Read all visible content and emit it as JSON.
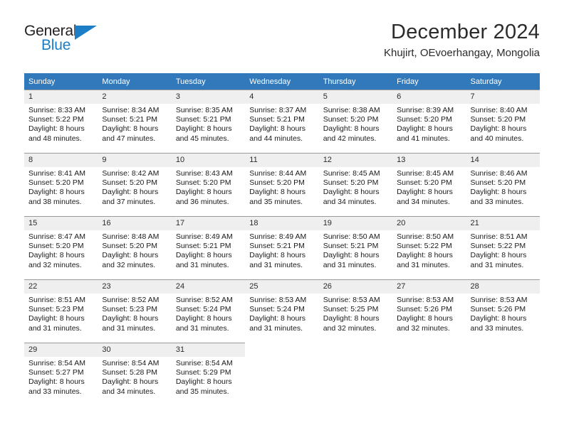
{
  "brand": {
    "name_top": "General",
    "name_bottom": "Blue",
    "accent_color": "#1b7ec6"
  },
  "header": {
    "month_title": "December 2024",
    "location": "Khujirt, OEvoerhangay, Mongolia"
  },
  "calendar": {
    "header_bg": "#3179ba",
    "daynum_bg": "#efefef",
    "weekdays": [
      "Sunday",
      "Monday",
      "Tuesday",
      "Wednesday",
      "Thursday",
      "Friday",
      "Saturday"
    ],
    "weeks": [
      [
        {
          "day": "1",
          "sunrise": "Sunrise: 8:33 AM",
          "sunset": "Sunset: 5:22 PM",
          "daylight1": "Daylight: 8 hours",
          "daylight2": "and 48 minutes."
        },
        {
          "day": "2",
          "sunrise": "Sunrise: 8:34 AM",
          "sunset": "Sunset: 5:21 PM",
          "daylight1": "Daylight: 8 hours",
          "daylight2": "and 47 minutes."
        },
        {
          "day": "3",
          "sunrise": "Sunrise: 8:35 AM",
          "sunset": "Sunset: 5:21 PM",
          "daylight1": "Daylight: 8 hours",
          "daylight2": "and 45 minutes."
        },
        {
          "day": "4",
          "sunrise": "Sunrise: 8:37 AM",
          "sunset": "Sunset: 5:21 PM",
          "daylight1": "Daylight: 8 hours",
          "daylight2": "and 44 minutes."
        },
        {
          "day": "5",
          "sunrise": "Sunrise: 8:38 AM",
          "sunset": "Sunset: 5:20 PM",
          "daylight1": "Daylight: 8 hours",
          "daylight2": "and 42 minutes."
        },
        {
          "day": "6",
          "sunrise": "Sunrise: 8:39 AM",
          "sunset": "Sunset: 5:20 PM",
          "daylight1": "Daylight: 8 hours",
          "daylight2": "and 41 minutes."
        },
        {
          "day": "7",
          "sunrise": "Sunrise: 8:40 AM",
          "sunset": "Sunset: 5:20 PM",
          "daylight1": "Daylight: 8 hours",
          "daylight2": "and 40 minutes."
        }
      ],
      [
        {
          "day": "8",
          "sunrise": "Sunrise: 8:41 AM",
          "sunset": "Sunset: 5:20 PM",
          "daylight1": "Daylight: 8 hours",
          "daylight2": "and 38 minutes."
        },
        {
          "day": "9",
          "sunrise": "Sunrise: 8:42 AM",
          "sunset": "Sunset: 5:20 PM",
          "daylight1": "Daylight: 8 hours",
          "daylight2": "and 37 minutes."
        },
        {
          "day": "10",
          "sunrise": "Sunrise: 8:43 AM",
          "sunset": "Sunset: 5:20 PM",
          "daylight1": "Daylight: 8 hours",
          "daylight2": "and 36 minutes."
        },
        {
          "day": "11",
          "sunrise": "Sunrise: 8:44 AM",
          "sunset": "Sunset: 5:20 PM",
          "daylight1": "Daylight: 8 hours",
          "daylight2": "and 35 minutes."
        },
        {
          "day": "12",
          "sunrise": "Sunrise: 8:45 AM",
          "sunset": "Sunset: 5:20 PM",
          "daylight1": "Daylight: 8 hours",
          "daylight2": "and 34 minutes."
        },
        {
          "day": "13",
          "sunrise": "Sunrise: 8:45 AM",
          "sunset": "Sunset: 5:20 PM",
          "daylight1": "Daylight: 8 hours",
          "daylight2": "and 34 minutes."
        },
        {
          "day": "14",
          "sunrise": "Sunrise: 8:46 AM",
          "sunset": "Sunset: 5:20 PM",
          "daylight1": "Daylight: 8 hours",
          "daylight2": "and 33 minutes."
        }
      ],
      [
        {
          "day": "15",
          "sunrise": "Sunrise: 8:47 AM",
          "sunset": "Sunset: 5:20 PM",
          "daylight1": "Daylight: 8 hours",
          "daylight2": "and 32 minutes."
        },
        {
          "day": "16",
          "sunrise": "Sunrise: 8:48 AM",
          "sunset": "Sunset: 5:20 PM",
          "daylight1": "Daylight: 8 hours",
          "daylight2": "and 32 minutes."
        },
        {
          "day": "17",
          "sunrise": "Sunrise: 8:49 AM",
          "sunset": "Sunset: 5:21 PM",
          "daylight1": "Daylight: 8 hours",
          "daylight2": "and 31 minutes."
        },
        {
          "day": "18",
          "sunrise": "Sunrise: 8:49 AM",
          "sunset": "Sunset: 5:21 PM",
          "daylight1": "Daylight: 8 hours",
          "daylight2": "and 31 minutes."
        },
        {
          "day": "19",
          "sunrise": "Sunrise: 8:50 AM",
          "sunset": "Sunset: 5:21 PM",
          "daylight1": "Daylight: 8 hours",
          "daylight2": "and 31 minutes."
        },
        {
          "day": "20",
          "sunrise": "Sunrise: 8:50 AM",
          "sunset": "Sunset: 5:22 PM",
          "daylight1": "Daylight: 8 hours",
          "daylight2": "and 31 minutes."
        },
        {
          "day": "21",
          "sunrise": "Sunrise: 8:51 AM",
          "sunset": "Sunset: 5:22 PM",
          "daylight1": "Daylight: 8 hours",
          "daylight2": "and 31 minutes."
        }
      ],
      [
        {
          "day": "22",
          "sunrise": "Sunrise: 8:51 AM",
          "sunset": "Sunset: 5:23 PM",
          "daylight1": "Daylight: 8 hours",
          "daylight2": "and 31 minutes."
        },
        {
          "day": "23",
          "sunrise": "Sunrise: 8:52 AM",
          "sunset": "Sunset: 5:23 PM",
          "daylight1": "Daylight: 8 hours",
          "daylight2": "and 31 minutes."
        },
        {
          "day": "24",
          "sunrise": "Sunrise: 8:52 AM",
          "sunset": "Sunset: 5:24 PM",
          "daylight1": "Daylight: 8 hours",
          "daylight2": "and 31 minutes."
        },
        {
          "day": "25",
          "sunrise": "Sunrise: 8:53 AM",
          "sunset": "Sunset: 5:24 PM",
          "daylight1": "Daylight: 8 hours",
          "daylight2": "and 31 minutes."
        },
        {
          "day": "26",
          "sunrise": "Sunrise: 8:53 AM",
          "sunset": "Sunset: 5:25 PM",
          "daylight1": "Daylight: 8 hours",
          "daylight2": "and 32 minutes."
        },
        {
          "day": "27",
          "sunrise": "Sunrise: 8:53 AM",
          "sunset": "Sunset: 5:26 PM",
          "daylight1": "Daylight: 8 hours",
          "daylight2": "and 32 minutes."
        },
        {
          "day": "28",
          "sunrise": "Sunrise: 8:53 AM",
          "sunset": "Sunset: 5:26 PM",
          "daylight1": "Daylight: 8 hours",
          "daylight2": "and 33 minutes."
        }
      ],
      [
        {
          "day": "29",
          "sunrise": "Sunrise: 8:54 AM",
          "sunset": "Sunset: 5:27 PM",
          "daylight1": "Daylight: 8 hours",
          "daylight2": "and 33 minutes."
        },
        {
          "day": "30",
          "sunrise": "Sunrise: 8:54 AM",
          "sunset": "Sunset: 5:28 PM",
          "daylight1": "Daylight: 8 hours",
          "daylight2": "and 34 minutes."
        },
        {
          "day": "31",
          "sunrise": "Sunrise: 8:54 AM",
          "sunset": "Sunset: 5:29 PM",
          "daylight1": "Daylight: 8 hours",
          "daylight2": "and 35 minutes."
        },
        {
          "day": "",
          "sunrise": "",
          "sunset": "",
          "daylight1": "",
          "daylight2": ""
        },
        {
          "day": "",
          "sunrise": "",
          "sunset": "",
          "daylight1": "",
          "daylight2": ""
        },
        {
          "day": "",
          "sunrise": "",
          "sunset": "",
          "daylight1": "",
          "daylight2": ""
        },
        {
          "day": "",
          "sunrise": "",
          "sunset": "",
          "daylight1": "",
          "daylight2": ""
        }
      ]
    ]
  }
}
